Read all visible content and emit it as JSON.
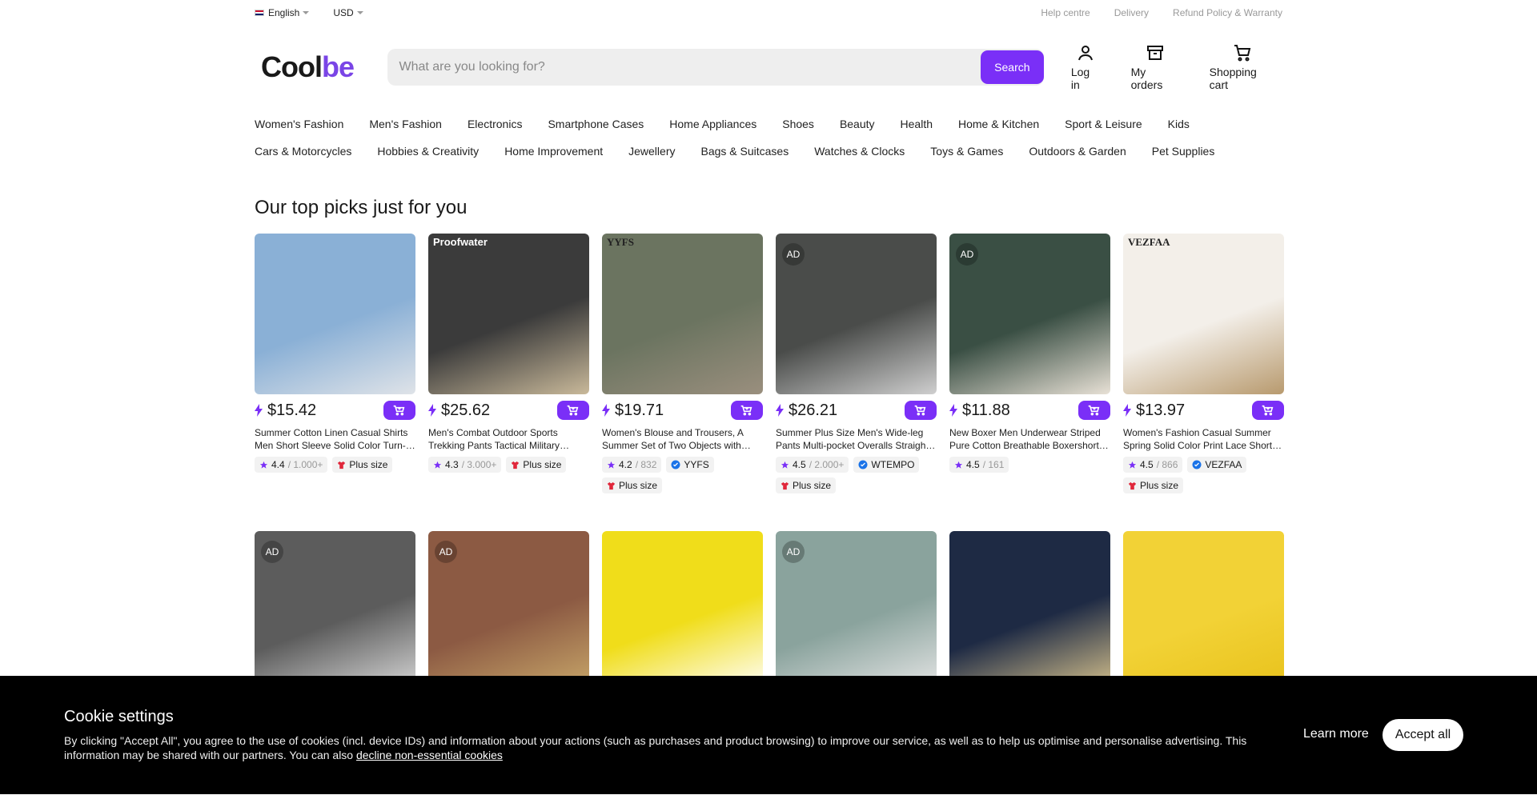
{
  "topbar": {
    "language": "English",
    "currency": "USD",
    "links": [
      "Help centre",
      "Delivery",
      "Refund Policy & Warranty"
    ]
  },
  "header": {
    "logo_a": "Cool",
    "logo_b": "be",
    "search_placeholder": "What are you looking for?",
    "search_button": "Search",
    "login": "Log in",
    "orders": "My orders",
    "cart": "Shopping cart"
  },
  "categories": {
    "row1": [
      "Women's Fashion",
      "Men's Fashion",
      "Electronics",
      "Smartphone Cases",
      "Home Appliances",
      "Shoes",
      "Beauty",
      "Health",
      "Home & Kitchen",
      "Sport & Leisure",
      "Kids"
    ],
    "row2": [
      "Cars & Motorcycles",
      "Hobbies & Creativity",
      "Home Improvement",
      "Jewellery",
      "Bags & Suitcases",
      "Watches & Clocks",
      "Toys & Games",
      "Outdoors & Garden",
      "Pet Supplies"
    ]
  },
  "section_title": "Our top picks just for you",
  "products": [
    {
      "price": "$15.42",
      "title": "Summer Cotton Linen Casual Shirts Men Short Sleeve Solid Color Turn-down Collar",
      "rating": "4.4",
      "count": "/ 1.000+",
      "brand": "",
      "plus": "Plus size",
      "ad": "",
      "img_text": "",
      "colors": [
        "#8ab0d6",
        "#dfe3e8"
      ]
    },
    {
      "price": "$25.62",
      "title": "Men's Combat Outdoor Sports Trekking Pants Tactical Military Trousers",
      "rating": "4.3",
      "count": "/ 3.000+",
      "brand": "",
      "plus": "Plus size",
      "ad": "",
      "img_text": "Proofwater",
      "colors": [
        "#3b3b3b",
        "#c9b99a"
      ]
    },
    {
      "price": "$19.71",
      "title": "Women's Blouse and Trousers, A Summer Set of Two Objects with Pockets",
      "rating": "4.2",
      "count": "/ 832",
      "brand": "YYFS",
      "plus": "Plus size",
      "ad": "",
      "img_text": "YYFS",
      "colors": [
        "#6b7460",
        "#9a8f7e"
      ]
    },
    {
      "price": "$26.21",
      "title": "Summer Plus Size Men's Wide-leg Pants Multi-pocket Overalls Straight Trousers",
      "rating": "4.5",
      "count": "/ 2.000+",
      "brand": "WTEMPO",
      "plus": "Plus size",
      "ad": "AD",
      "img_text": "",
      "colors": [
        "#4a4c4a",
        "#cfcfcf"
      ]
    },
    {
      "price": "$11.88",
      "title": "New Boxer Men Underwear Striped Pure Cotton Breathable Boxershorts Male",
      "rating": "4.5",
      "count": "/ 161",
      "brand": "",
      "plus": "",
      "ad": "AD",
      "img_text": "",
      "colors": [
        "#3a4f44",
        "#e8e1d6"
      ]
    },
    {
      "price": "$13.97",
      "title": "Women's Fashion Casual Summer Spring Solid Color Print Lace Short Sleeve Blouse",
      "rating": "4.5",
      "count": "/ 866",
      "brand": "VEZFAA",
      "plus": "Plus size",
      "ad": "",
      "img_text": "VEZFAA",
      "colors": [
        "#f3efe9",
        "#b89a6e"
      ]
    }
  ],
  "products_row2": [
    {
      "ad": "AD",
      "colors": [
        "#5c5c5c",
        "#d8d8d8"
      ]
    },
    {
      "ad": "AD",
      "colors": [
        "#8c5a43",
        "#c9a86a"
      ]
    },
    {
      "ad": "",
      "colors": [
        "#f0dd1a",
        "#ffffff"
      ]
    },
    {
      "ad": "AD",
      "colors": [
        "#8aa39d",
        "#e6e6e6"
      ]
    },
    {
      "ad": "",
      "colors": [
        "#1e2a44",
        "#d9c48e"
      ]
    },
    {
      "ad": "",
      "colors": [
        "#f2d236",
        "#e8c21c"
      ]
    }
  ],
  "cookie": {
    "title": " Cookie settings",
    "text": "By clicking \"Accept All\", you agree to the use of cookies (incl. device IDs) and information about your actions (such as purchases and product browsing) to improve our service, as well as to help us optimise and personalise advertising. This information may be shared with our partners. You can also ",
    "decline": "decline non-essential cookies",
    "learn": "Learn more",
    "accept": "Accept all"
  },
  "accent": "#7a2ff7"
}
